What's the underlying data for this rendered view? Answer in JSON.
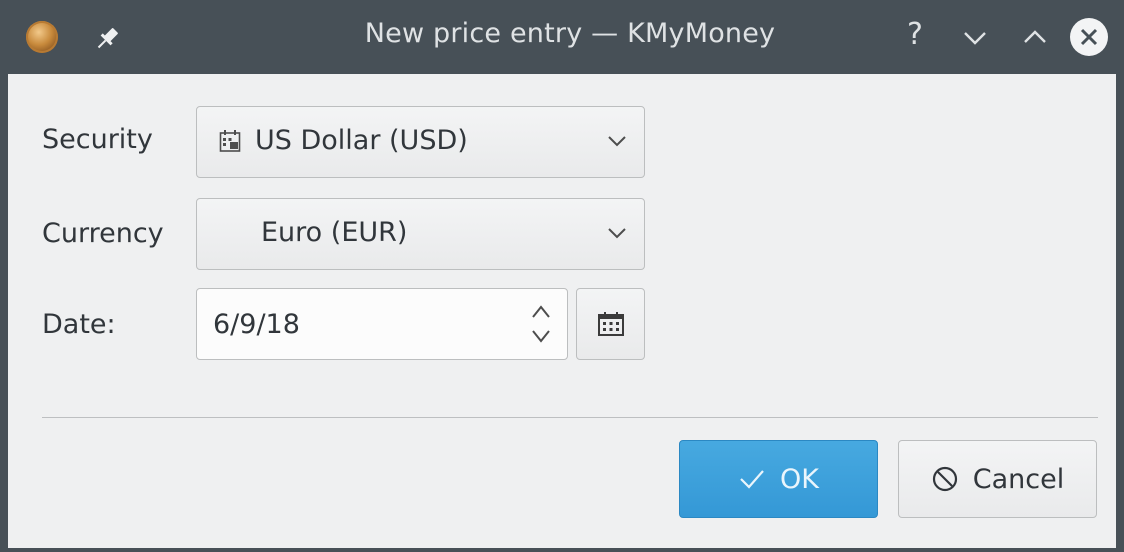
{
  "window": {
    "title": "New price entry — KMyMoney",
    "help_glyph": "?",
    "icons": [
      "kmymoney-app-icon",
      "pin-icon",
      "help-icon",
      "minimize-icon",
      "maximize-icon",
      "close-icon"
    ]
  },
  "form": {
    "security_label": "Security",
    "security_value": "US Dollar (USD)",
    "currency_label": "Currency",
    "currency_value": "Euro (EUR)",
    "date_label": "Date:",
    "date_value": "6/9/18"
  },
  "buttons": {
    "ok_label": "OK",
    "cancel_label": "Cancel"
  },
  "colors": {
    "titlebar": "#475057",
    "dialog_background": "#eff0f1",
    "ok_button": "#3daee9",
    "text": "#31363b"
  }
}
